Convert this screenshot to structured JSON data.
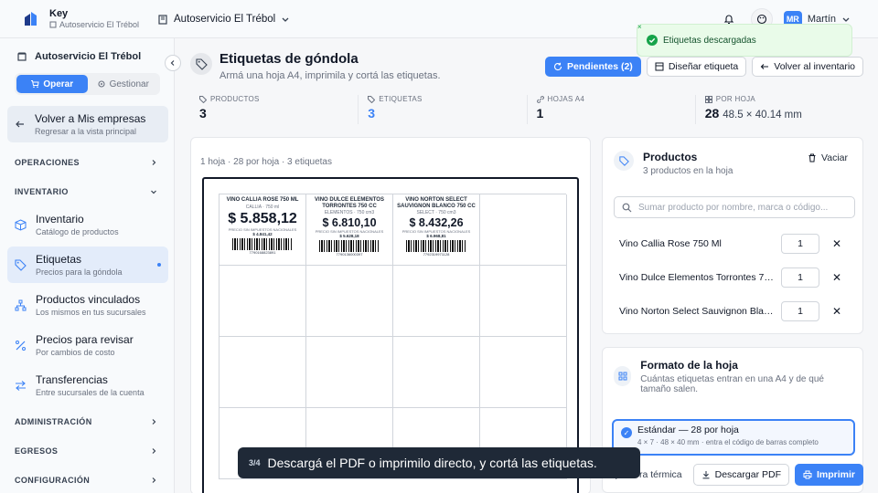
{
  "brand": {
    "name": "Key",
    "store": "Autoservicio El Trébol"
  },
  "header": {
    "store_switch": "Autoservicio El Trébol",
    "user_initials": "MR",
    "user_name": "Martín"
  },
  "sidebar": {
    "store": "Autoservicio El Trébol",
    "mode_tabs": [
      "Operar",
      "Gestionar"
    ],
    "back": {
      "title": "Volver a Mis empresas",
      "subtitle": "Regresar a la vista principal"
    },
    "sections": [
      "OPERACIONES",
      "INVENTARIO",
      "ADMINISTRACIÓN",
      "EGRESOS",
      "CONFIGURACIÓN"
    ],
    "items": [
      {
        "title": "Inventario",
        "subtitle": "Catálogo de productos"
      },
      {
        "title": "Etiquetas",
        "subtitle": "Precios para la góndola"
      },
      {
        "title": "Productos vinculados",
        "subtitle": "Los mismos en tus sucursales"
      },
      {
        "title": "Precios para revisar",
        "subtitle": "Por cambios de costo"
      },
      {
        "title": "Transferencias",
        "subtitle": "Entre sucursales de la cuenta"
      }
    ]
  },
  "page": {
    "title": "Etiquetas de góndola",
    "subtitle": "Armá una hoja A4, imprimila y cortá las etiquetas.",
    "actions": {
      "pending": "Pendientes (2)",
      "design": "Diseñar etiqueta",
      "back": "Volver al inventario"
    }
  },
  "stats": [
    {
      "label": "PRODUCTOS",
      "value": "3"
    },
    {
      "label": "ETIQUETAS",
      "value": "3"
    },
    {
      "label": "HOJAS A4",
      "value": "1"
    },
    {
      "label": "POR HOJA",
      "value": "28",
      "extra": "48.5 × 40.14 mm"
    }
  ],
  "preview": {
    "meta": "1 hoja · 28 por hoja · 3 etiquetas",
    "labels": [
      {
        "name": "VINO CALLIA ROSE 750 ML",
        "sub": "CALLIA · 750 ml",
        "price": "$ 5.858,12",
        "note": "PRECIO SIN IMPUESTOS NACIONALES",
        "net": "$ 4.841,42",
        "code": "7790168823891"
      },
      {
        "name": "VINO DULCE ELEMENTOS TORRONTES 750 CC",
        "sub": "ELEMENTOS · 750 cm3",
        "price": "$ 6.810,10",
        "note": "PRECIO SIN IMPUESTOS NACIONALES",
        "net": "$ 5.628,18",
        "code": "7790136000397"
      },
      {
        "name": "VINO NORTON SELECT SAUVIGNON BLANCO 750 CC",
        "sub": "SELECT · 750 cm3",
        "price": "$ 8.432,26",
        "note": "PRECIO SIN IMPUESTOS NACIONALES",
        "net": "$ 6.968,81",
        "code": "7792319971128"
      }
    ]
  },
  "products_panel": {
    "title": "Productos",
    "subtitle": "3 productos en la hoja",
    "clear": "Vaciar",
    "search_placeholder": "Sumar producto por nombre, marca o código...",
    "items": [
      {
        "name": "Vino Callia Rose 750 Ml",
        "qty": "1"
      },
      {
        "name": "Vino Dulce Elementos Torrontes 750 ...",
        "qty": "1"
      },
      {
        "name": "Vino Norton Select Sauvignon Blanc...",
        "qty": "1"
      }
    ]
  },
  "format_panel": {
    "title": "Formato de la hoja",
    "subtitle": "Cuántas etiquetas entran en una A4 y de qué tamaño salen.",
    "option_title": "Estándar — 28 por hoja",
    "option_sub": "4 × 7 · 48 × 40 mm · entra el código de barras completo"
  },
  "footer": {
    "thermal": "Impresora térmica",
    "download": "Descargar PDF",
    "print": "Imprimir"
  },
  "toast": {
    "message": "Etiquetas descargadas"
  },
  "caption": {
    "step": "3/4",
    "text": "Descargá el PDF o imprimilo directo, y cortá las etiquetas."
  },
  "colors": {
    "accent": "#3b82f6",
    "success": "#16a34a"
  }
}
